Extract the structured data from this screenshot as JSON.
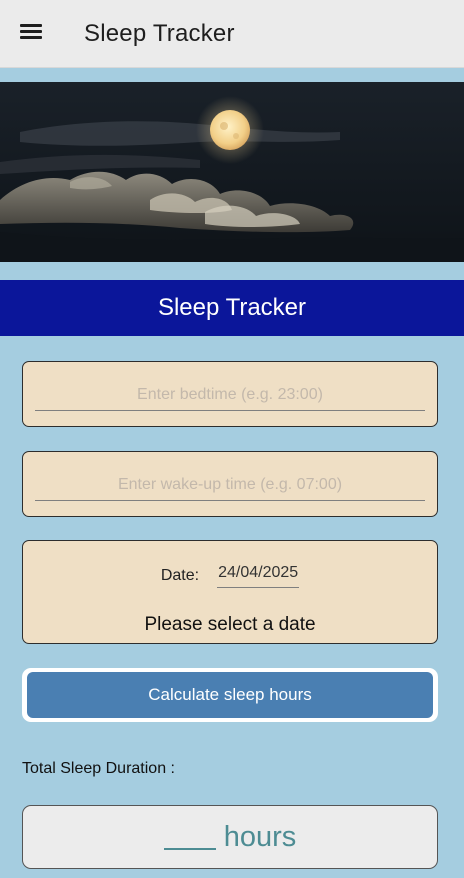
{
  "app_bar": {
    "title": "Sleep Tracker",
    "menu_icon": "hamburger-menu-icon"
  },
  "hero": {
    "image": "night sky with full moon and clouds"
  },
  "banner": {
    "title": "Sleep Tracker"
  },
  "bedtime": {
    "placeholder": "Enter bedtime (e.g. 23:00)",
    "value": ""
  },
  "waketime": {
    "placeholder": "Enter wake-up time (e.g. 07:00)",
    "value": ""
  },
  "date_picker": {
    "label": "Date:",
    "value": "24/04/2025",
    "prompt": "Please select a date"
  },
  "calculate_button": {
    "label": "Calculate sleep hours"
  },
  "result": {
    "label": "Total Sleep Duration :",
    "value": "",
    "unit": "hours"
  },
  "colors": {
    "background": "#a5cde0",
    "app_bar": "#ebebeb",
    "banner": "#0b169a",
    "card": "#efdfc5",
    "button": "#4a7fb2",
    "result_text": "#4d8c93"
  }
}
